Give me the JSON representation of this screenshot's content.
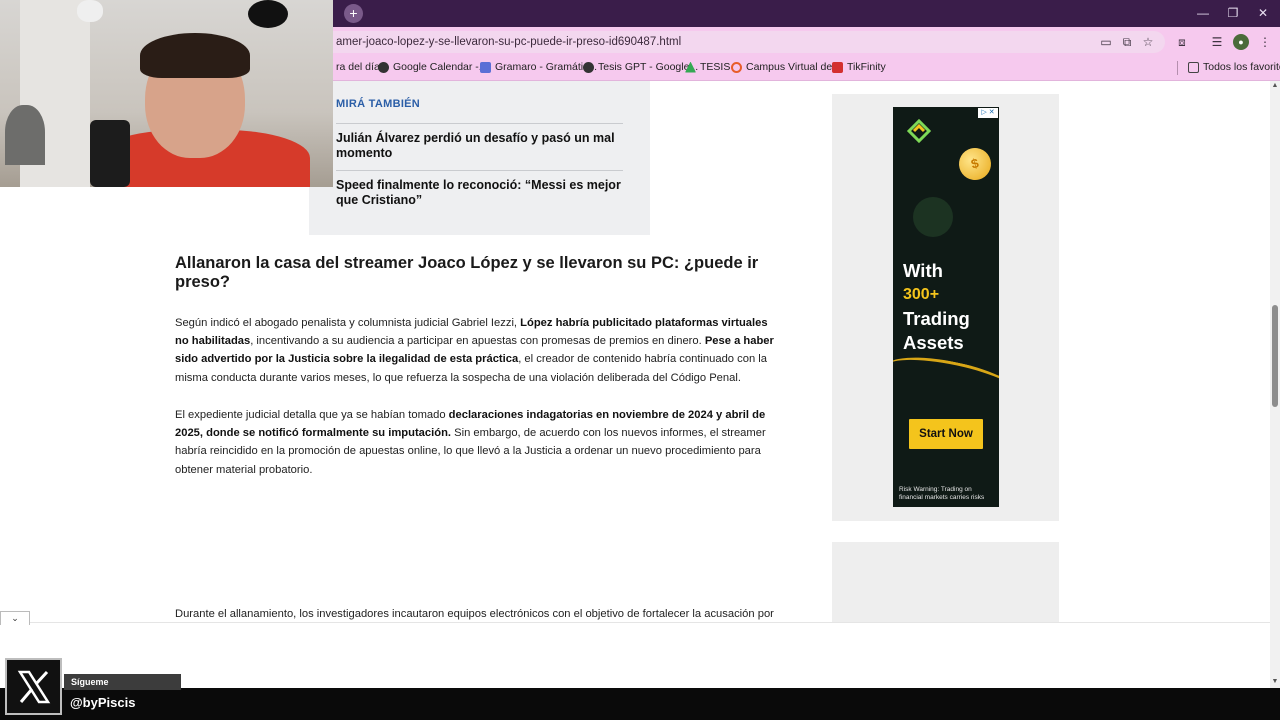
{
  "browser": {
    "url": "amer-joaco-lopez-y-se-llevaron-su-pc-puede-ir-preso-id690487.html",
    "new_tab_label": "+",
    "window_controls": [
      "—",
      "❐",
      "✕"
    ],
    "bookmarks": [
      {
        "label": "ra del día",
        "color": "#f0f0f0"
      },
      {
        "label": "Google Calendar -...",
        "color": "#333333"
      },
      {
        "label": "Gramaro - Gramátic...",
        "color": "#5a6fd6"
      },
      {
        "label": "Tesis GPT - Google...",
        "color": "#333333"
      },
      {
        "label": "TESIS",
        "color": "#34a853"
      },
      {
        "label": "Campus Virtual del...",
        "color": "#e85d2a"
      },
      {
        "label": "TikFinity",
        "color": "#d32f2f"
      }
    ],
    "favorites_label": "Todos los favoritos"
  },
  "related": {
    "title": "MIRÁ TAMBIÉN",
    "items": [
      "Julián Álvarez perdió un desafío y pasó un mal momento",
      "Speed finalmente lo reconoció: “Messi es mejor que Cristiano”"
    ]
  },
  "article": {
    "headline": "Allanaron la casa del streamer Joaco López y se llevaron su PC: ¿puede ir preso?",
    "p1": [
      {
        "t": "Según indicó el abogado penalista y columnista judicial Gabriel Iezzi, ",
        "b": false
      },
      {
        "t": "López habría publicitado plataformas virtuales no habilitadas",
        "b": true
      },
      {
        "t": ", incentivando a su audiencia a participar en apuestas con promesas de premios en dinero. ",
        "b": false
      },
      {
        "t": "Pese a haber sido advertido por la Justicia sobre la ilegalidad de esta práctica",
        "b": true
      },
      {
        "t": ", el creador de contenido habría continuado con la misma conducta durante varios meses, lo que refuerza la sospecha de una violación deliberada del Código Penal.",
        "b": false
      }
    ],
    "p2": [
      {
        "t": "El expediente judicial detalla que ya se habían tomado ",
        "b": false
      },
      {
        "t": "declaraciones indagatorias en noviembre de 2024 y abril de 2025, donde se notificó formalmente su imputación.",
        "b": true
      },
      {
        "t": " Sin embargo, de acuerdo con los nuevos informes, el streamer habría reincidido en la promoción de apuestas online, lo que llevó a la Justicia a ordenar un nuevo procedimiento para obtener material probatorio.",
        "b": false
      }
    ],
    "p3": "Durante el allanamiento, los investigadores incautaron equipos electrónicos con el objetivo de fortalecer la acusación por"
  },
  "ad": {
    "with": "With",
    "count": "300+",
    "trading": "Trading",
    "assets": "Assets",
    "cta": "Start Now",
    "risk": "Risk Warning: Trading on financial markets carries risks",
    "coin": "$",
    "badge": "▷ ✕",
    "brand_color": "#f4c41c"
  },
  "overlay": {
    "follow": "Sígueme",
    "handle": "@byPiscis",
    "collapse": "⌄"
  }
}
